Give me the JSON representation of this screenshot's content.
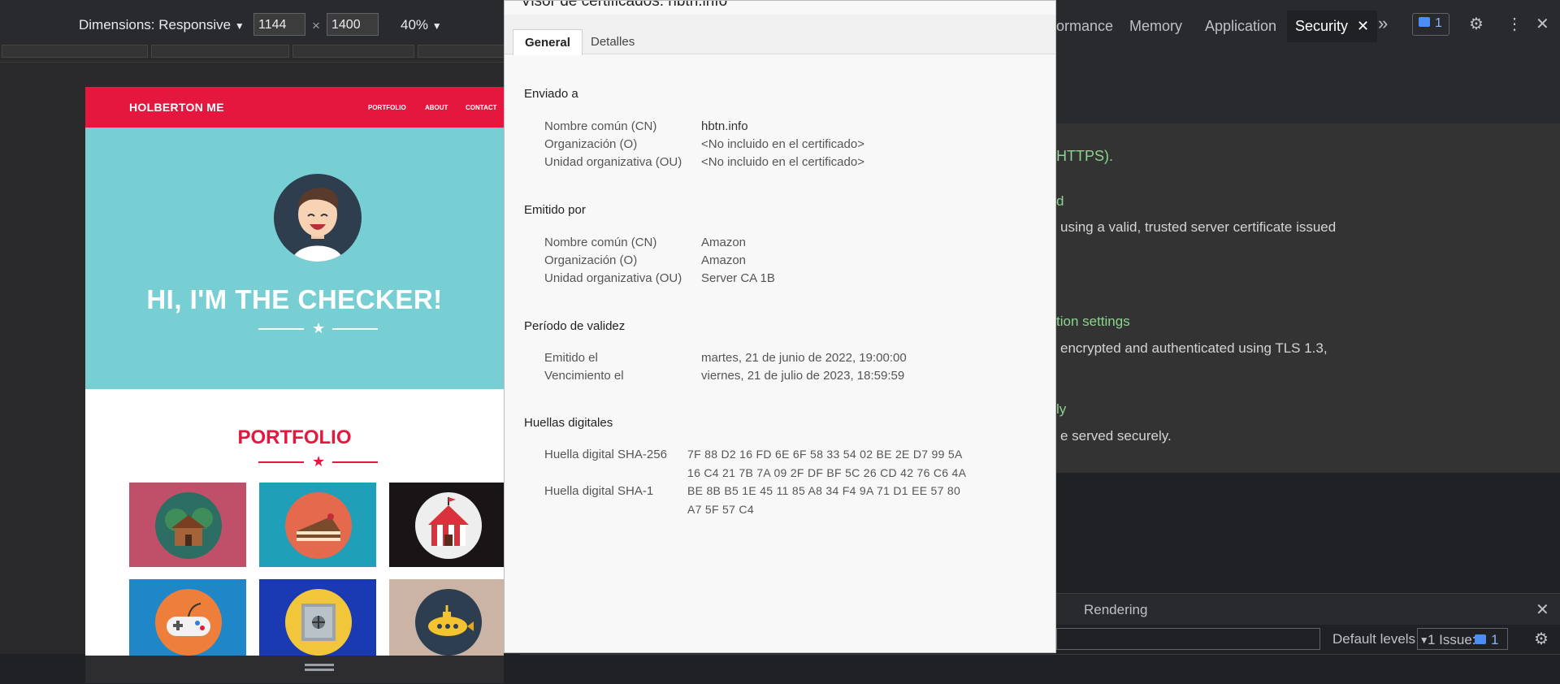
{
  "device_toolbar": {
    "dimensions_label": "Dimensions: Responsive",
    "width_value": "1144",
    "times_symbol": "×",
    "height_value": "1400",
    "zoom_label": "40%"
  },
  "website": {
    "brand": "HOLBERTON ME",
    "nav_links": [
      "PORTFOLIO",
      "ABOUT",
      "CONTACT"
    ],
    "hero_title": "HI, I'M THE CHECKER!",
    "portfolio_title": "PORTFOLIO",
    "colors": {
      "primary": "#e5173f",
      "hero_bg": "#78cfd3"
    },
    "tiles": [
      {
        "icon": "cabin-icon",
        "bg": "#c0506a",
        "circle": "#2c6e63"
      },
      {
        "icon": "cake-icon",
        "bg": "#1fa0b8",
        "circle": "#e5694d"
      },
      {
        "icon": "circus-tent-icon",
        "bg": "#191516",
        "circle": "#eeeeee"
      },
      {
        "icon": "gamepad-icon",
        "bg": "#1f86c7",
        "circle": "#ee7f3b"
      },
      {
        "icon": "safe-icon",
        "bg": "#1a3ab3",
        "circle": "#f1c63a"
      },
      {
        "icon": "submarine-icon",
        "bg": "#cbb4a5",
        "circle": "#2d3e50"
      }
    ]
  },
  "dialog": {
    "title": "Visor de certificados: hbtn.info",
    "tabs": [
      "General",
      "Detalles"
    ],
    "sections": {
      "issued_to": {
        "heading": "Enviado a",
        "rows": [
          {
            "label": "Nombre común (CN)",
            "value": "hbtn.info"
          },
          {
            "label": "Organización (O)",
            "value": "<No incluido en el certificado>"
          },
          {
            "label": "Unidad organizativa (OU)",
            "value": "<No incluido en el certificado>"
          }
        ]
      },
      "issued_by": {
        "heading": "Emitido por",
        "rows": [
          {
            "label": "Nombre común (CN)",
            "value": "Amazon"
          },
          {
            "label": "Organización (O)",
            "value": "Amazon"
          },
          {
            "label": "Unidad organizativa (OU)",
            "value": "Server CA 1B"
          }
        ]
      },
      "validity": {
        "heading": "Período de validez",
        "rows": [
          {
            "label": "Emitido el",
            "value": "martes, 21 de junio de 2022, 19:00:00"
          },
          {
            "label": "Vencimiento el",
            "value": "viernes, 21 de julio de 2023, 18:59:59"
          }
        ]
      },
      "fingerprints": {
        "heading": "Huellas digitales",
        "sha256_label": "Huella digital SHA-256",
        "sha256_line1": "7F 88 D2 16 FD 6E 6F 58 33 54 02 BE 2E D7 99 5A",
        "sha256_line2": "16 C4 21 7B 7A 09 2F DF BF 5C 26 CD 42 76 C6 4A",
        "sha1_label": "Huella digital SHA-1",
        "sha1_line1": "BE 8B B5 1E 45 11 85 A8 34 F4 9A 71 D1 EE 57 80",
        "sha1_line2": "A7 5F 57 C4"
      }
    }
  },
  "devtools": {
    "tabs": [
      "ormance",
      "Memory",
      "Application",
      "Security"
    ],
    "more_tabs": "»",
    "issues_badge": "1",
    "security_panel": {
      "line1": "HTTPS).",
      "line2": "d",
      "line3": "using a valid, trusted server certificate issued",
      "line4": "tion settings",
      "line5": "encrypted and authenticated using TLS 1.3,",
      "line6": "ly",
      "line7": "e served securely."
    },
    "drawer": {
      "rendering_tab": "Rendering",
      "levels_label": "Default levels",
      "issues_label": "1 Issue:",
      "issues_count": "1"
    }
  }
}
